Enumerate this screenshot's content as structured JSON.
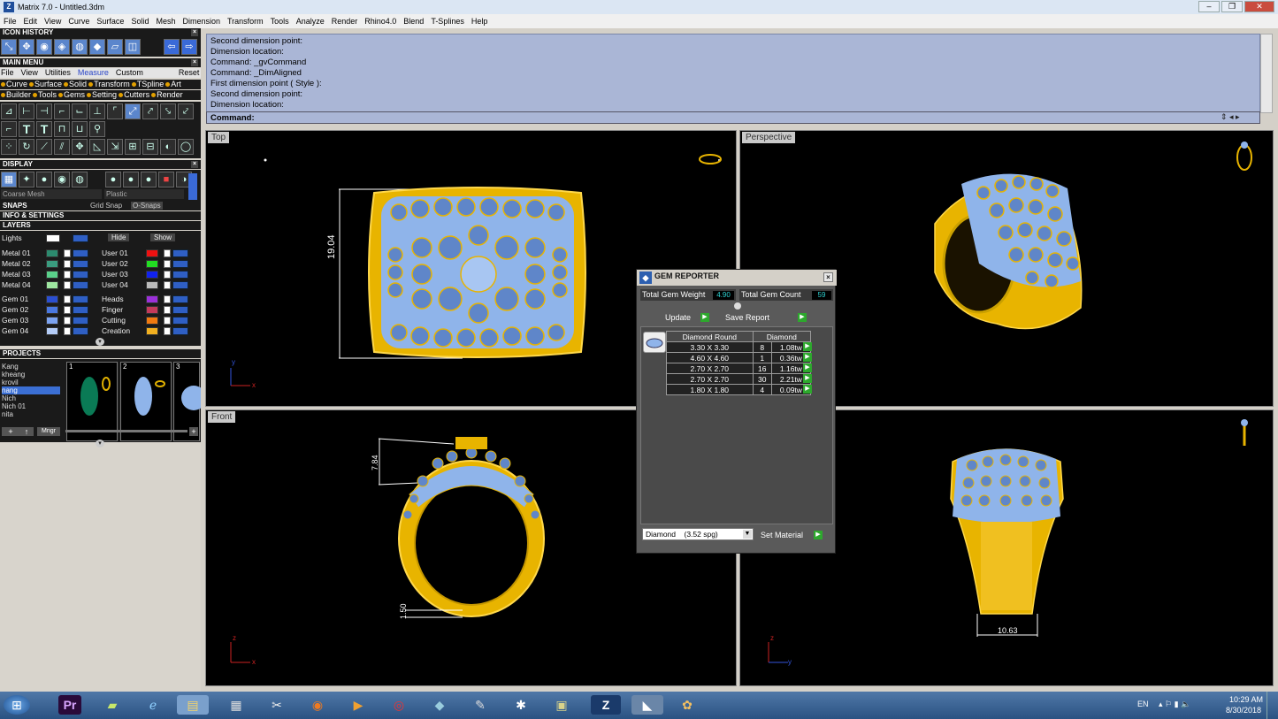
{
  "window": {
    "title": "Matrix 7.0 - Untitled.3dm",
    "app_icon": "Z"
  },
  "menubar": [
    "File",
    "Edit",
    "View",
    "Curve",
    "Surface",
    "Solid",
    "Mesh",
    "Dimension",
    "Transform",
    "Tools",
    "Analyze",
    "Render",
    "Rhino4.0",
    "Blend",
    "T-Splines",
    "Help"
  ],
  "left": {
    "icon_history": "ICON HISTORY",
    "main_menu": "MAIN MENU",
    "main_menu_tabs": [
      "File",
      "View",
      "Utilities",
      "Measure",
      "Custom",
      "Reset"
    ],
    "mm_row1": [
      "Curve",
      "Surface",
      "Solid",
      "Transform",
      "TSpline",
      "Art"
    ],
    "mm_row2": [
      "Builder",
      "Tools",
      "Gems",
      "Setting",
      "Cutters",
      "Render"
    ],
    "display": "DISPLAY",
    "display_mode": "Coarse Mesh",
    "display_material": "Plastic",
    "snaps": "SNAPS",
    "grid_snap": "Grid Snap",
    "o_snaps": "O-Snaps",
    "info": "INFO & SETTINGS",
    "layers": "LAYERS",
    "lights": "Lights",
    "hide": "Hide",
    "show": "Show",
    "layers_left": [
      "Metal 01",
      "Metal 02",
      "Metal 03",
      "Metal 04",
      "Gem 01",
      "Gem 02",
      "Gem 03",
      "Gem 04"
    ],
    "layers_right": [
      "User 01",
      "User 02",
      "User 03",
      "User 04",
      "Heads",
      "Finger",
      "Cutting",
      "Creation"
    ],
    "projects": "PROJECTS",
    "project_names": [
      "Kang",
      "kheang",
      "krovil",
      "nang",
      "Nich",
      "Nich 01",
      "nita"
    ],
    "thumb_nums": [
      "1",
      "2",
      "3"
    ],
    "mngr": "Mngr"
  },
  "command_history": [
    "Second dimension point:",
    "Dimension location:",
    "Command: _gvCommand",
    "Command: _DimAligned",
    "First dimension point ( Style ):",
    "Second dimension point:",
    "Dimension location:"
  ],
  "command_prompt": "Command:",
  "viewports": {
    "top": "Top",
    "perspective": "Perspective",
    "front": "Front"
  },
  "dimensions": {
    "top": "19.04",
    "front_a": "7.84",
    "front_b": "1.50",
    "right": "10.63"
  },
  "gem_reporter": {
    "title": "GEM REPORTER",
    "total_weight_label": "Total Gem Weight",
    "total_weight": "4.90",
    "total_count_label": "Total Gem Count",
    "total_count": "59",
    "update": "Update",
    "save_report": "Save Report",
    "col1": "Diamond Round",
    "col2": "Diamond",
    "rows": [
      {
        "size": "3.30 X 3.30",
        "count": "8",
        "wt": "1.08tw"
      },
      {
        "size": "4.60 X 4.60",
        "count": "1",
        "wt": "0.36tw"
      },
      {
        "size": "2.70 X 2.70",
        "count": "16",
        "wt": "1.16tw"
      },
      {
        "size": "2.70 X 2.70",
        "count": "30",
        "wt": "2.21tw"
      },
      {
        "size": "1.80 X 1.80",
        "count": "4",
        "wt": "0.09tw"
      }
    ],
    "material": "Diamond",
    "material_spg": "(3.52 spg)",
    "set_material": "Set Material"
  },
  "taskbar": {
    "lang": "EN",
    "time": "10:29 AM",
    "date": "8/30/2018"
  },
  "colors": {
    "gold": "#e8b400",
    "gem": "#8fb4ea",
    "cmd_bg": "#aab6d6"
  }
}
